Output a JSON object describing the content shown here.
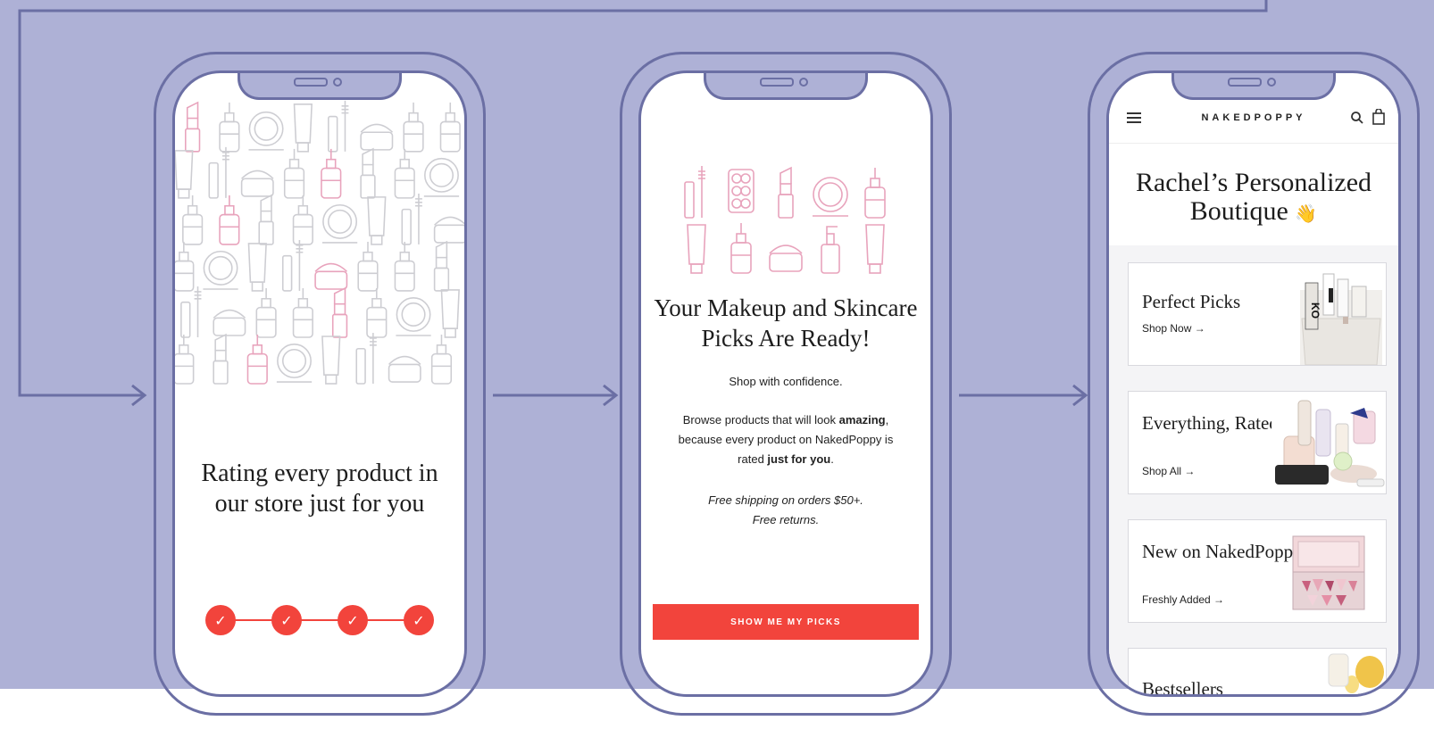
{
  "colors": {
    "background": "#aeb1d6",
    "outline": "#6b6fa4",
    "accent": "#f2443c",
    "icon_pink": "#e8a3bc",
    "icon_grey": "#cdcdd2"
  },
  "phone1": {
    "title": "Rating every product in our store just for you",
    "steps": [
      "✓",
      "✓",
      "✓",
      "✓"
    ]
  },
  "phone2": {
    "title": "Your Makeup and Skincare Picks Are Ready!",
    "tagline": "Shop with confidence.",
    "body_before": "Browse products that will look ",
    "body_bold1": "amazing",
    "body_middle": ", because every product on NakedPoppy is rated ",
    "body_bold2": "just for you",
    "body_after": ".",
    "shipping_line1": "Free shipping on orders $50+.",
    "shipping_line2": "Free returns.",
    "cta": "SHOW ME MY PICKS"
  },
  "phone3": {
    "brand": "NAKEDPOPPY",
    "page_title": "Rachel’s Personalized Boutique",
    "wave_emoji": "👋",
    "cards": [
      {
        "title": "Perfect Picks",
        "link": "Shop Now  →"
      },
      {
        "title": "Everything, Rated For You",
        "link": "Shop All  →"
      },
      {
        "title": "New on NakedPoppy",
        "link": "Freshly Added  →"
      },
      {
        "title": "Bestsellers",
        "link": ""
      }
    ]
  }
}
